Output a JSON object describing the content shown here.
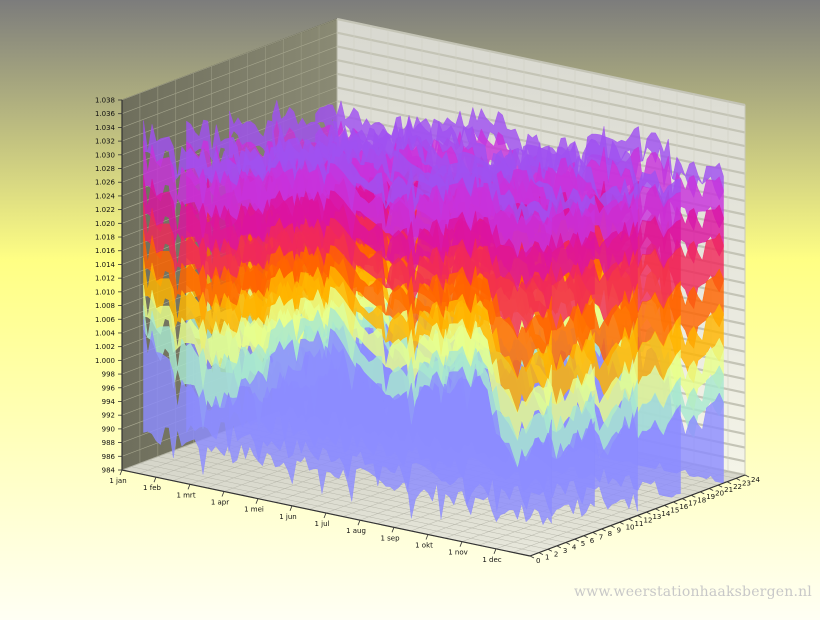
{
  "chart_data": {
    "type": "area",
    "mode": "3d-surface",
    "x_ticks": [
      "1 jan",
      "1 feb",
      "1 mrt",
      "1 apr",
      "1 mei",
      "1 jun",
      "1 jul",
      "1 aug",
      "1 sep",
      "1 okt",
      "1 nov",
      "1 dec"
    ],
    "z_ticks": [
      "0",
      "1",
      "2",
      "3",
      "4",
      "5",
      "6",
      "7",
      "8",
      "9",
      "10",
      "11",
      "12",
      "13",
      "14",
      "15",
      "16",
      "17",
      "18",
      "19",
      "20",
      "21",
      "22",
      "23",
      "24"
    ],
    "y_ticks": [
      "984",
      "986",
      "988",
      "990",
      "992",
      "994",
      "996",
      "998",
      "1.000",
      "1.002",
      "1.004",
      "1.006",
      "1.008",
      "1.010",
      "1.012",
      "1.014",
      "1.016",
      "1.018",
      "1.020",
      "1.022",
      "1.024",
      "1.026",
      "1.028",
      "1.030",
      "1.032",
      "1.034",
      "1.036",
      "1.038"
    ],
    "ylim": [
      984,
      1038
    ],
    "zlim": [
      0,
      24
    ],
    "series": [
      {
        "name": "",
        "values": [
          1001,
          995,
          992,
          998,
          1004,
          1006,
          1000,
          999,
          1003,
          1005,
          993,
          999
        ],
        "color": "#8c8cff"
      },
      {
        "name": "",
        "values": [
          1003,
          1001,
          998,
          1002,
          1007,
          1009,
          1004,
          1003,
          1006,
          1008,
          997,
          1003
        ],
        "color": "#a8e8d0"
      },
      {
        "name": "",
        "values": [
          1006,
          1004,
          1003,
          1006,
          1010,
          1012,
          1008,
          1007,
          1010,
          1012,
          1001,
          1007
        ],
        "color": "#e8ff8c"
      },
      {
        "name": "",
        "values": [
          1010,
          1008,
          1007,
          1010,
          1014,
          1015,
          1011,
          1011,
          1013,
          1016,
          1006,
          1012
        ],
        "color": "#ffb400"
      },
      {
        "name": "",
        "values": [
          1014,
          1012,
          1011,
          1014,
          1017,
          1018,
          1015,
          1015,
          1017,
          1020,
          1012,
          1017
        ],
        "color": "#ff6400"
      },
      {
        "name": "",
        "values": [
          1018,
          1016,
          1015,
          1018,
          1021,
          1022,
          1019,
          1019,
          1021,
          1024,
          1019,
          1022
        ],
        "color": "#f0285a"
      },
      {
        "name": "",
        "values": [
          1022,
          1021,
          1020,
          1022,
          1025,
          1026,
          1023,
          1023,
          1025,
          1028,
          1024,
          1026
        ],
        "color": "#dc14a0"
      },
      {
        "name": "",
        "values": [
          1027,
          1026,
          1025,
          1027,
          1029,
          1030,
          1027,
          1028,
          1030,
          1033,
          1029,
          1030
        ],
        "color": "#c832dc"
      },
      {
        "name": "",
        "values": [
          1030,
          1029,
          1028,
          1030,
          1032,
          1033,
          1030,
          1031,
          1033,
          1036,
          1031,
          1032
        ],
        "color": "#a050f0"
      }
    ],
    "grid": true,
    "legend": "none"
  },
  "watermark": "www.weerstationhaaksbergen.nl"
}
